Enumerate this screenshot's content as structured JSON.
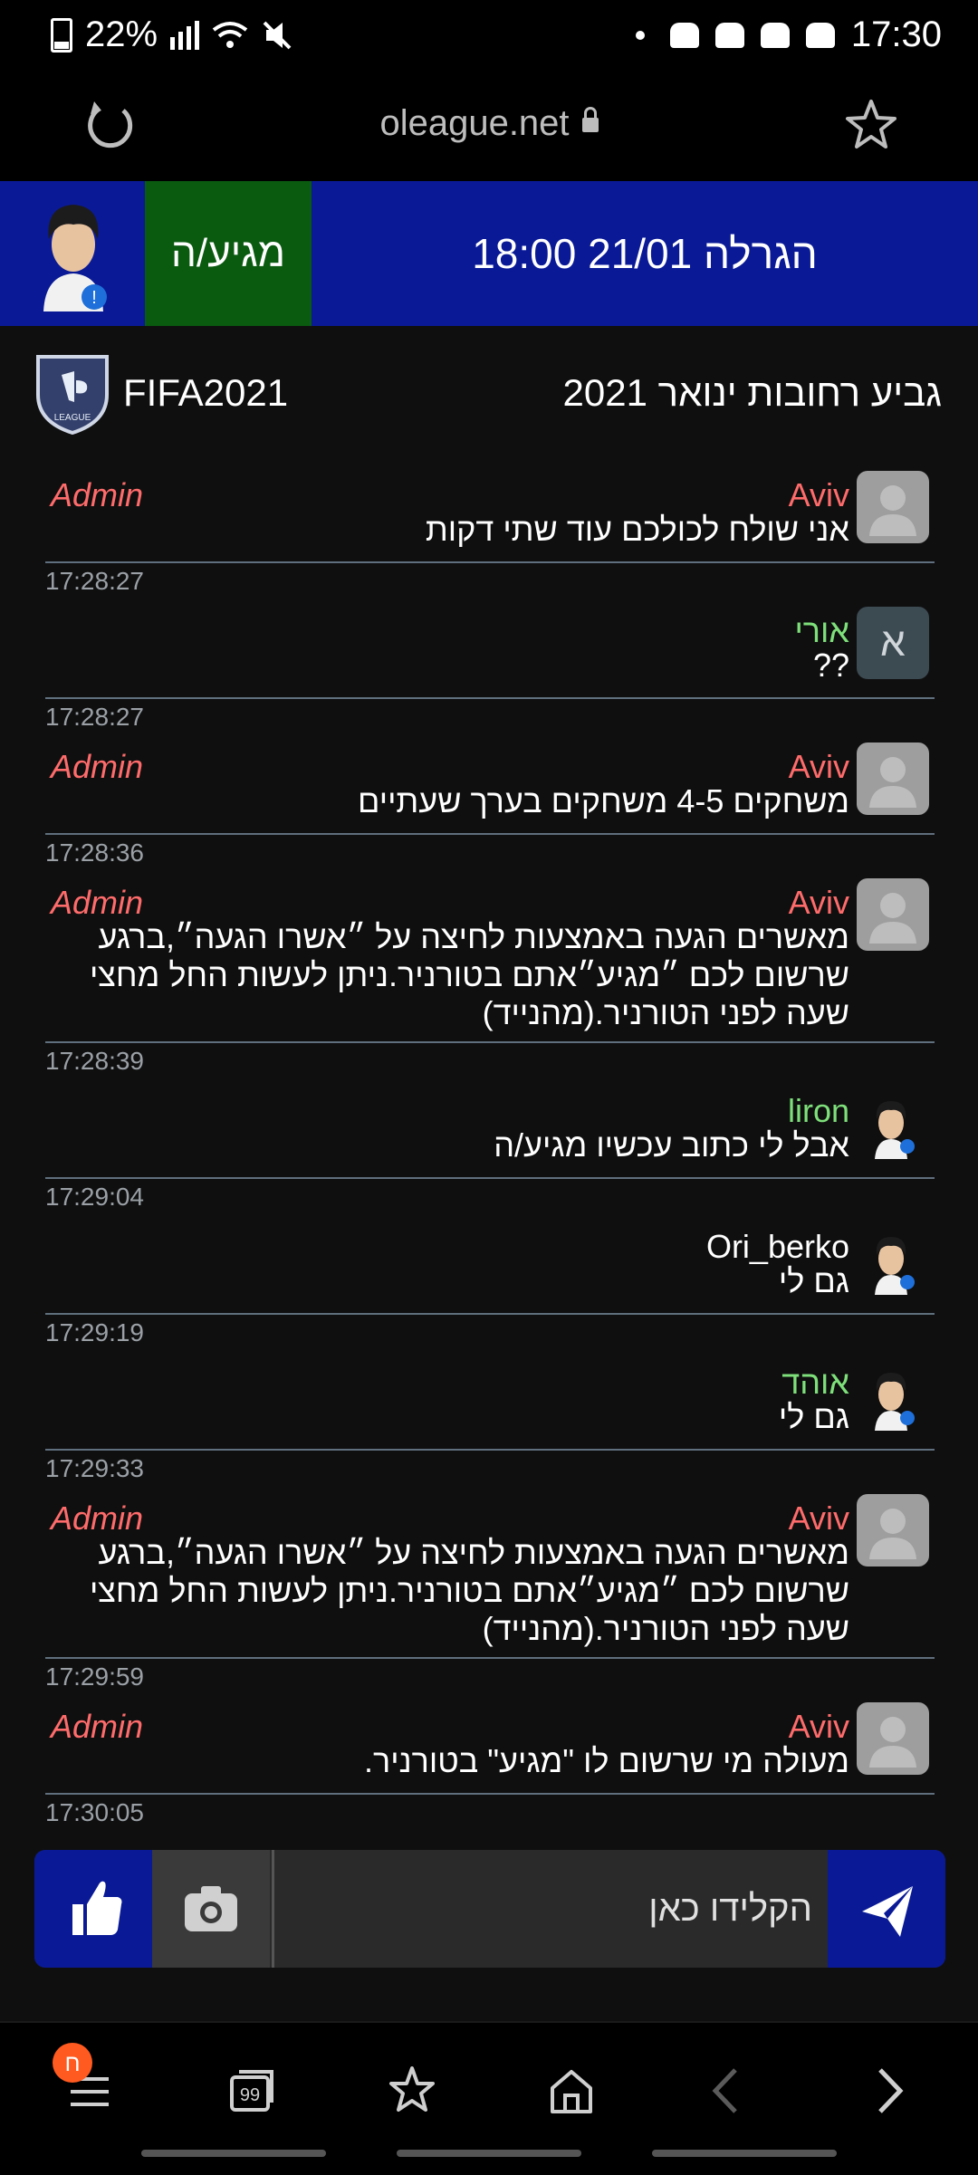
{
  "status_bar": {
    "battery": "22%",
    "time": "17:30"
  },
  "browser": {
    "url": "oleague.net"
  },
  "banner": {
    "arrived_label": "מגיע/ה",
    "draw_label": "הגרלה 21/01 18:00"
  },
  "tournament": {
    "game": "FIFA2021",
    "name": "גביע רחובות ינואר 2021"
  },
  "messages": [
    {
      "author": "Aviv",
      "admin": "Admin",
      "text": "אני שולח לכולכם עוד שתי דקות",
      "time": "17:28:27"
    },
    {
      "author": "אורי",
      "admin": "",
      "text": "??",
      "time": "17:28:27",
      "avatar_letter": "א"
    },
    {
      "author": "Aviv",
      "admin": "Admin",
      "text": "משחקים 4-5 משחקים בערך שעתיים",
      "time": "17:28:36"
    },
    {
      "author": "Aviv",
      "admin": "Admin",
      "text": "מאשרים הגעה באמצעות לחיצה על ״אשרו הגעה״,ברגע שרשום לכם ״מגיע״אתם בטורניר.ניתן לעשות החל מחצי שעה לפני הטורניר.(מהנייד)",
      "time": "17:28:39"
    },
    {
      "author": "liron",
      "admin": "",
      "text": "אבל לי כתוב עכשיו מגיע/ה",
      "time": "17:29:04"
    },
    {
      "author": "Ori_berko",
      "admin": "",
      "text": "גם לי",
      "time": "17:29:19"
    },
    {
      "author": "אוהד",
      "admin": "",
      "text": "גם לי",
      "time": "17:29:33"
    },
    {
      "author": "Aviv",
      "admin": "Admin",
      "text": "מאשרים הגעה באמצעות לחיצה על ״אשרו הגעה״,ברגע שרשום לכם ״מגיע״אתם בטורניר.ניתן לעשות החל מחצי שעה לפני הטורניר.(מהנייד)",
      "time": "17:29:59"
    },
    {
      "author": "Aviv",
      "admin": "Admin",
      "text": "מעולה מי שרשום לו \"מגיע\" בטורניר.",
      "time": "17:30:05"
    }
  ],
  "composer": {
    "placeholder": "הקלידו כאן"
  },
  "bottom_nav": {
    "tabs_count": "99",
    "menu_badge": "ח"
  },
  "colors": {
    "banner_blue": "#0a1a96",
    "arrived_green": "#0a5a10",
    "admin_red": "#ff6b6b",
    "user_green": "#7ee07a",
    "badge_orange": "#ff5a1f"
  }
}
